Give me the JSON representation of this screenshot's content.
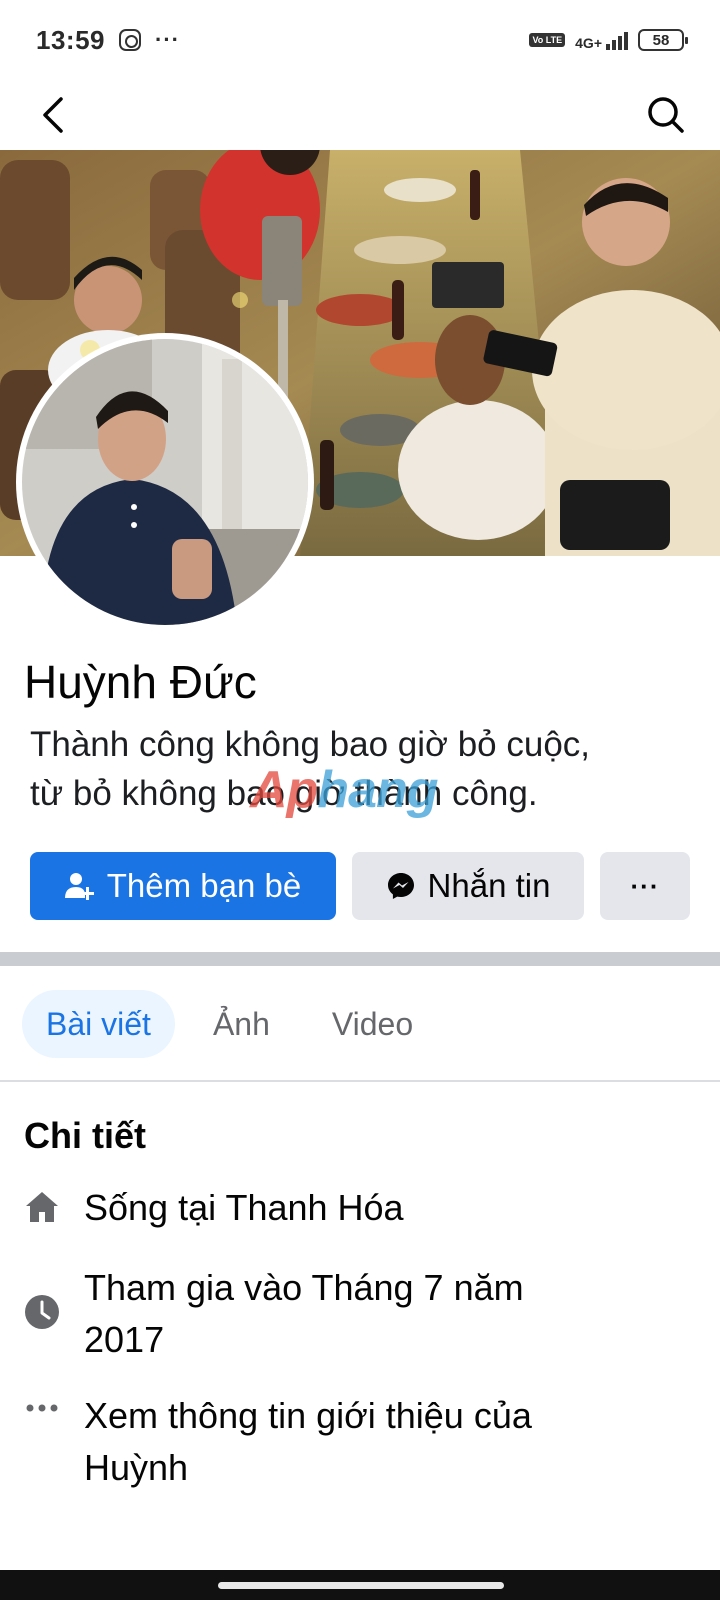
{
  "status_bar": {
    "time": "13:59",
    "more": "···",
    "volte": "Vo LTE",
    "network": "4G+",
    "battery": "58"
  },
  "profile": {
    "name": "Huỳnh Đức",
    "bio_line1": "Thành công không bao giờ bỏ cuộc,",
    "bio_line2": "từ bỏ không bao giờ thành công."
  },
  "watermark": {
    "part_a": "Ap",
    "part_b": "hang"
  },
  "actions": {
    "add_friend": "Thêm bạn bè",
    "message": "Nhắn tin",
    "more": "···"
  },
  "tabs": [
    {
      "label": "Bài viết",
      "active": true
    },
    {
      "label": "Ảnh",
      "active": false
    },
    {
      "label": "Video",
      "active": false
    }
  ],
  "details": {
    "title": "Chi tiết",
    "lives_in_prefix": "Sống tại ",
    "lives_in_place": "Thanh Hóa",
    "joined_line1": "Tham gia vào Tháng 7 năm",
    "joined_line2": "2017",
    "about_line1": "Xem thông tin giới thiệu của",
    "about_line2": "Huỳnh"
  },
  "colors": {
    "primary": "#1b74e4",
    "secondary_button": "#e4e6eb",
    "tab_active_bg": "#ebf5ff",
    "icon_gray": "#65676b"
  },
  "icons": {
    "back": "back-arrow-icon",
    "search": "search-icon",
    "add_friend": "add-friend-icon",
    "messenger": "messenger-icon",
    "home": "home-icon",
    "clock": "clock-icon",
    "more": "more-dots-icon"
  }
}
